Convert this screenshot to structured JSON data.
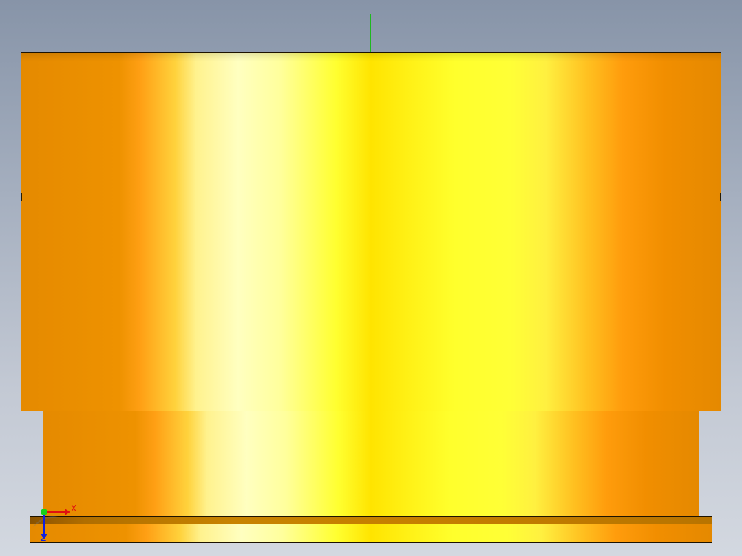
{
  "viewport": {
    "background_colors": [
      "#8794a8",
      "#d3d8e0"
    ]
  },
  "model": {
    "material_color": "#ffe400",
    "edge_color": "#1c1200",
    "parts": [
      "top-cylinder",
      "neck-cylinder",
      "base-lip",
      "base-plate"
    ]
  },
  "origin_axis": {
    "y_color": "#1fb81f"
  },
  "triad": {
    "x_label": "X",
    "z_label": "Z",
    "x_color": "#e01010",
    "y_color": "#18d018",
    "z_color": "#1020e0"
  }
}
